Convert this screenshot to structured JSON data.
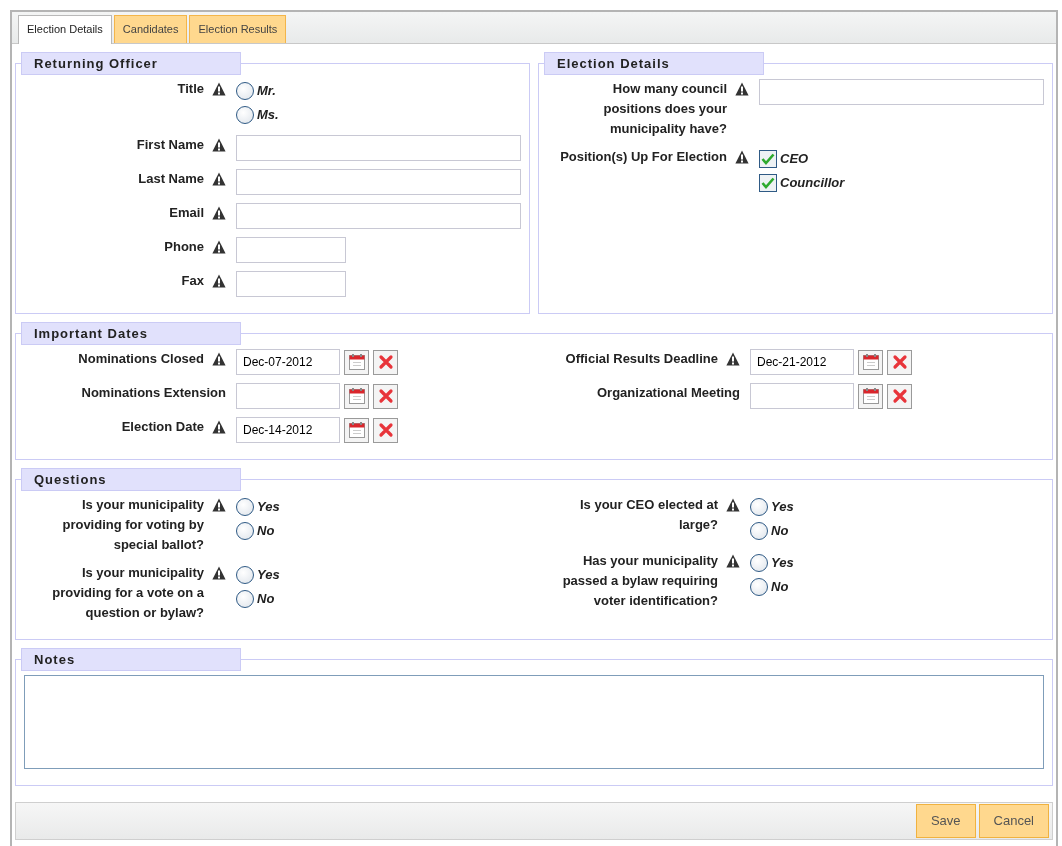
{
  "tabs": [
    {
      "label": "Election Details",
      "selected": true
    },
    {
      "label": "Candidates",
      "selected": false
    },
    {
      "label": "Election Results",
      "selected": false
    }
  ],
  "top_sections": [
    {
      "title": "Returning Officer",
      "columns": [
        [
          {
            "kind": "radio",
            "label": "Title",
            "required": true,
            "options": [
              {
                "label": "Mr.",
                "selected": false
              },
              {
                "label": "Ms.",
                "selected": false
              }
            ]
          },
          {
            "kind": "text",
            "label": "First Name",
            "required": true
          },
          {
            "kind": "text",
            "label": "Last Name",
            "required": true
          },
          {
            "kind": "text",
            "label": "Email",
            "required": true
          },
          {
            "kind": "shorttext",
            "label": "Phone",
            "required": true
          },
          {
            "kind": "shorttext",
            "label": "Fax",
            "required": true
          }
        ]
      ]
    },
    {
      "title": "Election Details",
      "columns": [
        [
          {
            "kind": "text",
            "label": "How many council positions does your municipality have?",
            "required": true
          },
          {
            "kind": "checkbox",
            "label": "Position(s) Up For Election",
            "required": true,
            "options": [
              {
                "label": "CEO",
                "checked": true
              },
              {
                "label": "Councillor",
                "checked": true
              }
            ]
          }
        ]
      ]
    }
  ],
  "sections": [
    {
      "title": "Important Dates",
      "columns": [
        [
          {
            "kind": "date",
            "label": "Nominations Closed",
            "required": true,
            "value": "Dec-07-2012"
          },
          {
            "kind": "date",
            "label": "Nominations Extension",
            "required": false
          },
          {
            "kind": "date",
            "label": "Election Date",
            "required": true,
            "value": "Dec-14-2012"
          }
        ],
        [
          {
            "kind": "date",
            "label": "Official Results Deadline",
            "required": true,
            "value": "Dec-21-2012"
          },
          {
            "kind": "date",
            "label": "Organizational Meeting",
            "required": false
          }
        ]
      ]
    },
    {
      "title": "Questions",
      "columns": [
        [
          {
            "kind": "radio",
            "label": "Is your municipality providing for voting by special ballot?",
            "required": true,
            "options": [
              {
                "label": "Yes",
                "selected": false
              },
              {
                "label": "No",
                "selected": false
              }
            ]
          },
          {
            "kind": "radio",
            "label": "Is your municipality providing for a vote on a question or bylaw?",
            "required": true,
            "options": [
              {
                "label": "Yes",
                "selected": false
              },
              {
                "label": "No",
                "selected": false
              }
            ]
          }
        ],
        [
          {
            "kind": "radio",
            "label": "Is your CEO elected at large?",
            "required": true,
            "options": [
              {
                "label": "Yes",
                "selected": false
              },
              {
                "label": "No",
                "selected": false
              }
            ]
          },
          {
            "kind": "radio",
            "label": "Has your municipality passed a bylaw requiring voter identification?",
            "required": true,
            "options": [
              {
                "label": "Yes",
                "selected": false
              },
              {
                "label": "No",
                "selected": false
              }
            ]
          }
        ]
      ]
    },
    {
      "title": "Notes",
      "columns": [
        [
          {
            "kind": "textarea"
          }
        ]
      ]
    }
  ],
  "buttons": [
    "Save",
    "Cancel"
  ]
}
